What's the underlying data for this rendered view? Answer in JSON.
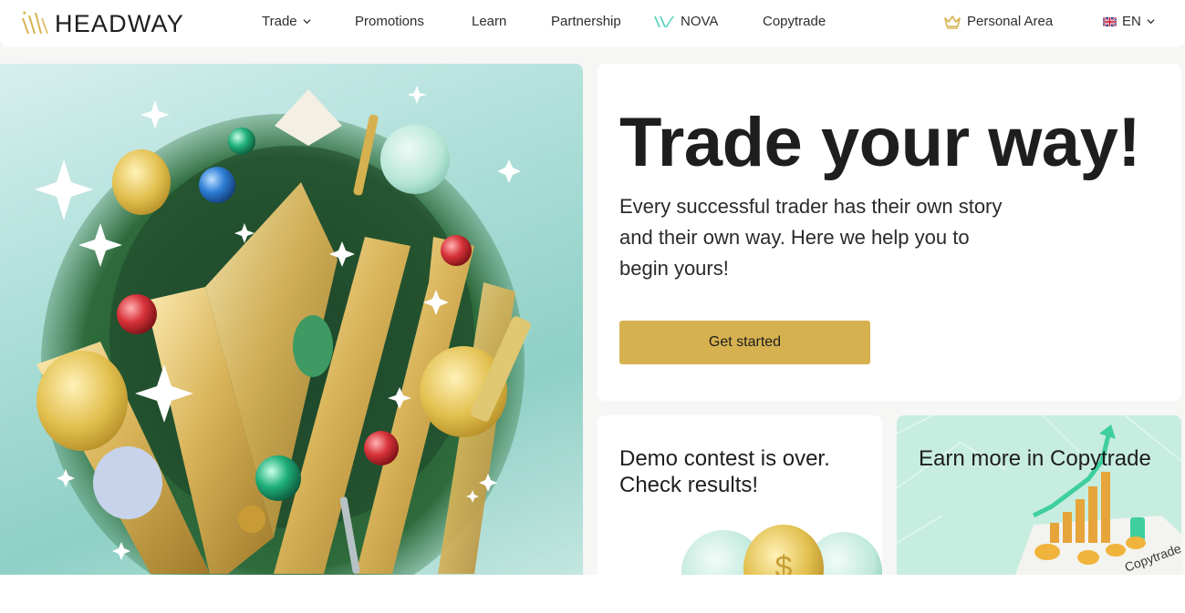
{
  "brand": {
    "name": "HEADWAY",
    "accent": "#d6b14f",
    "mint": "#5fd6c1"
  },
  "nav": {
    "trade": "Trade",
    "promotions": "Promotions",
    "learn": "Learn",
    "partnership": "Partnership",
    "nova": "NOVA",
    "copytrade": "Copytrade",
    "personal_area": "Personal Area",
    "language": "EN"
  },
  "hero": {
    "title": "Trade your way!",
    "subtitle": "Every successful trader has their own story and their own way. Here we help you to begin yours!",
    "cta": "Get started"
  },
  "cards": {
    "demo": "Demo contest is over. Check results!",
    "copytrade": "Earn more in Copytrade",
    "copytrade_badge": "Copytrade"
  },
  "icons": {
    "logo": "headway-logo-icon",
    "nova": "nova-icon",
    "crown": "crown-icon",
    "flag": "uk-flag-icon",
    "chevron": "chevron-down-icon"
  }
}
